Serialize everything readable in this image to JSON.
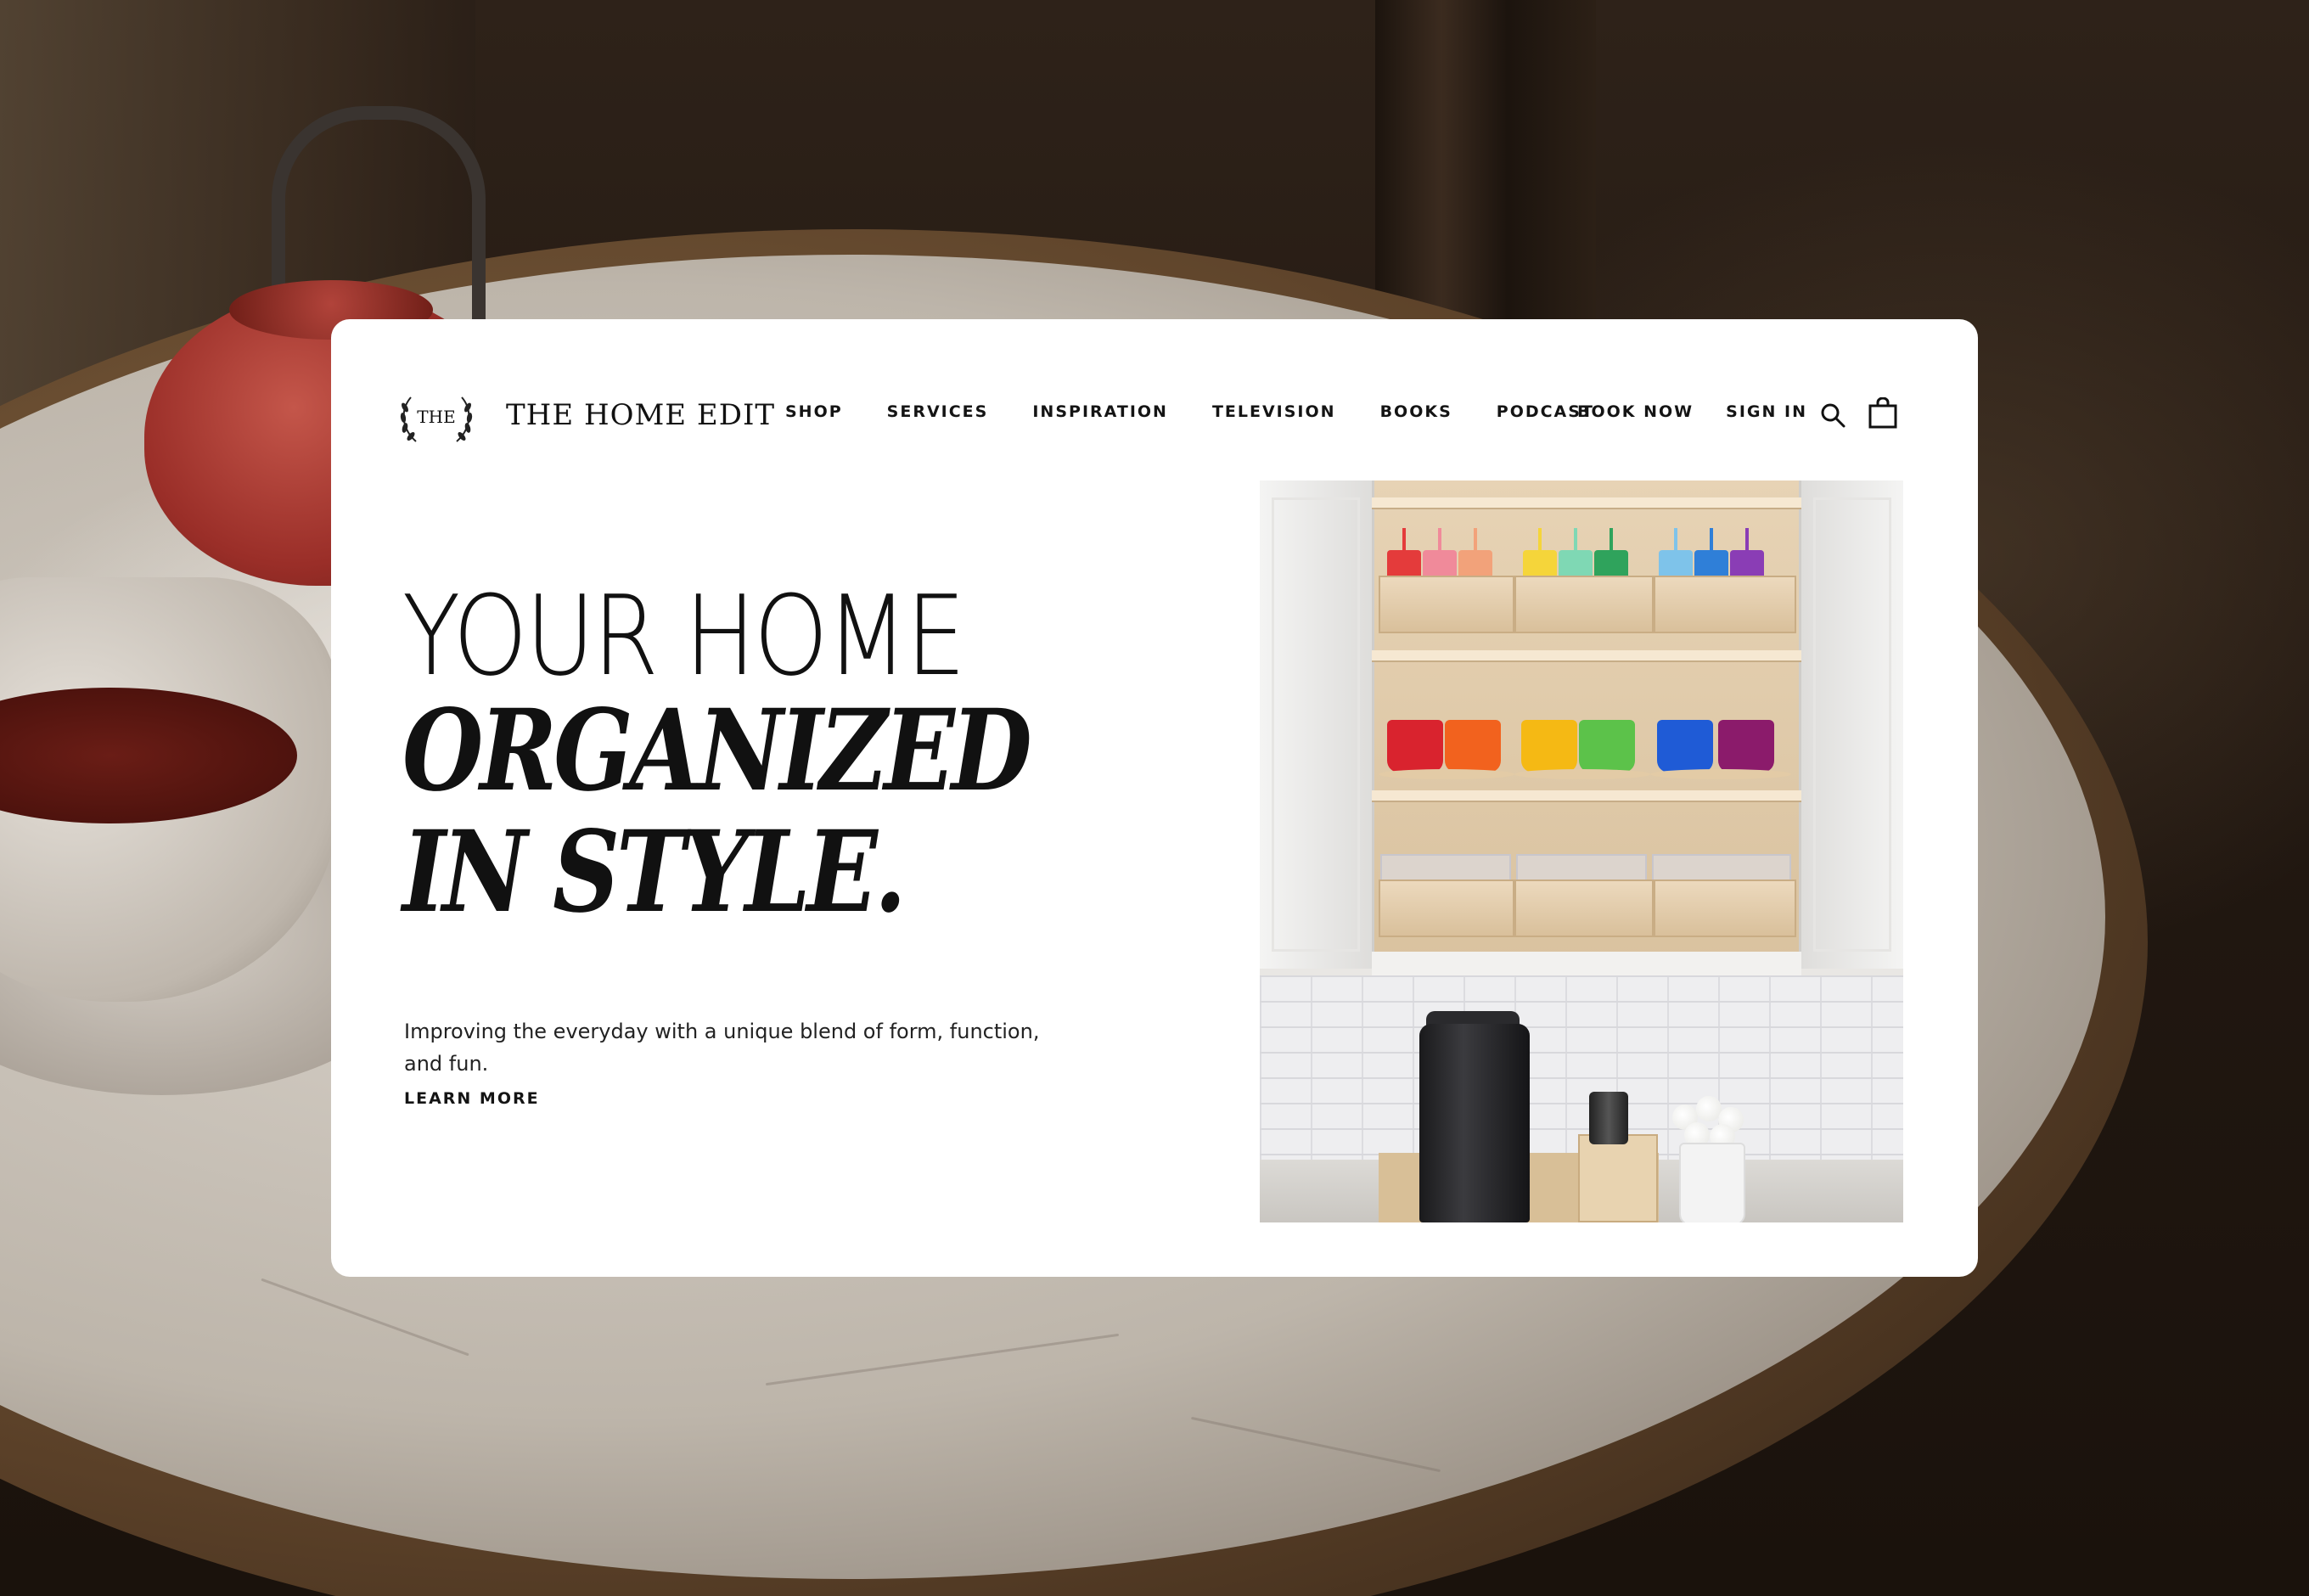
{
  "brand": {
    "monogram": "THE",
    "name": "THE HOME EDIT"
  },
  "nav": {
    "items": [
      {
        "label": "SHOP"
      },
      {
        "label": "SERVICES"
      },
      {
        "label": "INSPIRATION"
      },
      {
        "label": "TELEVISION"
      },
      {
        "label": "BOOKS"
      },
      {
        "label": "PODCAST"
      }
    ],
    "book_now": "BOOK NOW",
    "sign_in": "SIGN IN",
    "icons": [
      "search-icon",
      "shopping-bag-icon"
    ]
  },
  "hero": {
    "line1": "YOUR HOME",
    "line2": "ORGANIZED",
    "line3": "IN STYLE.",
    "subtitle": "Improving the everyday with a unique blend of form, function, and fun.",
    "cta": "LEARN MORE"
  },
  "colors": {
    "text": "#111111",
    "card": "#ffffff"
  }
}
